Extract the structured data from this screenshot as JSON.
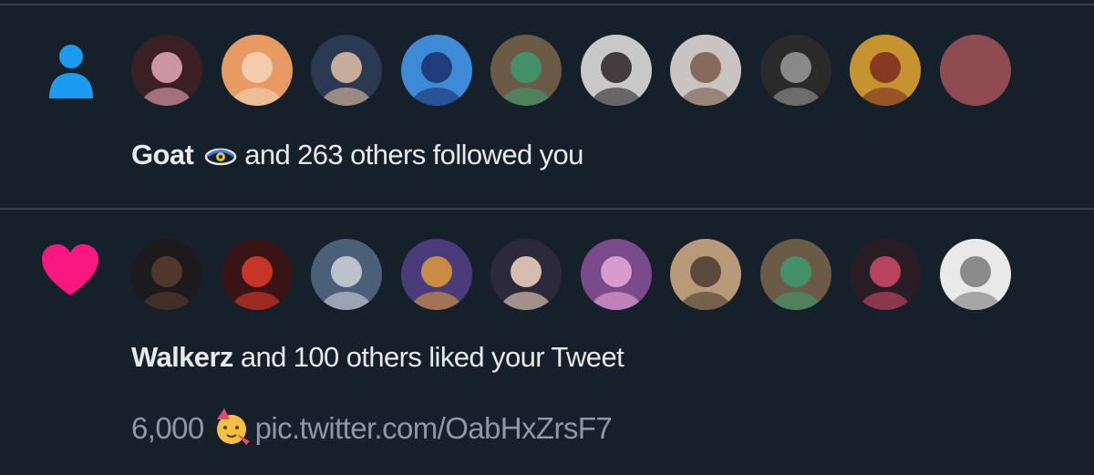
{
  "follow_notification": {
    "icon": "person-icon",
    "accent": "#1d9bf0",
    "user_name": "Goat",
    "user_badge": "eye-halo-icon",
    "rest": "and 263 others followed you",
    "avatars": [
      {
        "name": "follower-avatar",
        "bg": "#3a1f23",
        "fg": "#e7a9b8"
      },
      {
        "name": "follower-avatar",
        "bg": "#e79a63",
        "fg": "#f5d5b8"
      },
      {
        "name": "follower-avatar",
        "bg": "#2b3a52",
        "fg": "#e2c2a6"
      },
      {
        "name": "follower-avatar",
        "bg": "#3d8bd6",
        "fg": "#1b2e6b"
      },
      {
        "name": "follower-avatar",
        "bg": "#6b5a45",
        "fg": "#3d9a6e"
      },
      {
        "name": "follower-avatar",
        "bg": "#c8c8c8",
        "fg": "#2a2526"
      },
      {
        "name": "follower-avatar",
        "bg": "#c9c4c2",
        "fg": "#7b5a48"
      },
      {
        "name": "follower-avatar",
        "bg": "#2a2a2a",
        "fg": "#9a9a9a"
      },
      {
        "name": "follower-avatar",
        "bg": "#c7932f",
        "fg": "#7a2a1f"
      },
      {
        "name": "follower-avatar",
        "bg": "#8f4b52",
        "fg": "#8f4b52"
      }
    ]
  },
  "like_notification": {
    "icon": "heart-icon",
    "accent": "#f91880",
    "user_name": "Walkerz",
    "rest": "and 100 others liked your Tweet",
    "tweet_count": "6,000",
    "tweet_emoji": "party-face-icon",
    "tweet_link": "pic.twitter.com/OabHxZrsF7",
    "avatars": [
      {
        "name": "liker-avatar",
        "bg": "#1c1a1d",
        "fg": "#5a3c2e"
      },
      {
        "name": "liker-avatar",
        "bg": "#3a1414",
        "fg": "#e13b2a"
      },
      {
        "name": "liker-avatar",
        "bg": "#4c5f78",
        "fg": "#cfd3da"
      },
      {
        "name": "liker-avatar",
        "bg": "#4a3b7a",
        "fg": "#e09a3c"
      },
      {
        "name": "liker-avatar",
        "bg": "#2c2a3a",
        "fg": "#f2d6c4"
      },
      {
        "name": "liker-avatar",
        "bg": "#7a4a8a",
        "fg": "#e7a9d8"
      },
      {
        "name": "liker-avatar",
        "bg": "#b89a78",
        "fg": "#4a3c31"
      },
      {
        "name": "liker-avatar",
        "bg": "#6b5a45",
        "fg": "#3d9a6e"
      },
      {
        "name": "liker-avatar",
        "bg": "#2a1c24",
        "fg": "#d04a6a"
      },
      {
        "name": "liker-avatar",
        "bg": "#e9e9e9",
        "fg": "#7a7a7a"
      }
    ]
  }
}
